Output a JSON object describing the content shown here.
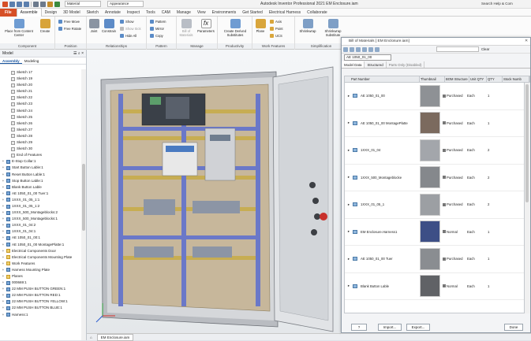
{
  "window": {
    "title": "Autodesk Inventor Professional 2021   EM Enclosure.iam",
    "material": "Material",
    "appearance": "Appearance",
    "help_search": "Search Help & Com"
  },
  "tabs": [
    "File",
    "Assemble",
    "Design",
    "3D Model",
    "Sketch",
    "Annotate",
    "Inspect",
    "Tools",
    "CAM",
    "Manage",
    "View",
    "Environments",
    "Get Started",
    "Electrical Harness",
    "Collaborate"
  ],
  "ribbon": {
    "component": {
      "label": "Component",
      "place": "Place from Content Center",
      "create": "Create"
    },
    "position": {
      "label": "Position",
      "free_move": "Free Move",
      "free_rotate": "Free Rotate"
    },
    "relationships": {
      "label": "Relationships",
      "joint": "Joint",
      "constrain": "Constrain",
      "show": "Show",
      "show_sick": "Show Sick",
      "hide_all": "Hide All"
    },
    "pattern": {
      "label": "Pattern",
      "pattern": "Pattern",
      "mirror": "Mirror",
      "copy": "Copy"
    },
    "manage": {
      "label": "Manage",
      "bom": "Bill of Materials",
      "parameters": "Parameters"
    },
    "productivity": {
      "label": "Productivity",
      "create_derived": "Create Derived Substitutes"
    },
    "work_features": {
      "label": "Work Features",
      "plane": "Plane",
      "axis": "Axis",
      "point": "Point",
      "ucs": "UCS"
    },
    "simplification": {
      "label": "Simplification",
      "shrinkwrap": "Shrinkwrap",
      "shrinkwrap_sub": "Shrinkwrap Substitute"
    }
  },
  "browser": {
    "title": "Model",
    "tabs": [
      "Assembly",
      "Modeling"
    ],
    "items": [
      {
        "label": "Sketch 17",
        "icon": "s",
        "pm": ""
      },
      {
        "label": "Sketch 19",
        "icon": "s",
        "pm": ""
      },
      {
        "label": "Sketch 20",
        "icon": "s",
        "pm": ""
      },
      {
        "label": "Sketch 21",
        "icon": "s",
        "pm": ""
      },
      {
        "label": "Sketch 22",
        "icon": "s",
        "pm": ""
      },
      {
        "label": "Sketch 23",
        "icon": "s",
        "pm": ""
      },
      {
        "label": "Sketch 24",
        "icon": "s",
        "pm": ""
      },
      {
        "label": "Sketch 25",
        "icon": "s",
        "pm": ""
      },
      {
        "label": "Sketch 26",
        "icon": "s",
        "pm": ""
      },
      {
        "label": "Sketch 27",
        "icon": "s",
        "pm": ""
      },
      {
        "label": "Sketch 28",
        "icon": "s",
        "pm": ""
      },
      {
        "label": "Sketch 29",
        "icon": "s",
        "pm": ""
      },
      {
        "label": "Sketch 30",
        "icon": "s",
        "pm": ""
      },
      {
        "label": "End of Features",
        "icon": "s",
        "pm": ""
      },
      {
        "label": "E-Stop Collar:1",
        "icon": "p",
        "pm": "+"
      },
      {
        "label": "Start Button Lable:1",
        "icon": "p",
        "pm": "+"
      },
      {
        "label": "Reset Button Lable:1",
        "icon": "p",
        "pm": "+"
      },
      {
        "label": "Stop Button Lable:1",
        "icon": "p",
        "pm": "+"
      },
      {
        "label": "Blank Button Lable",
        "icon": "p",
        "pm": "+"
      },
      {
        "label": "AE 1050_01_00 Tuer:1",
        "icon": "p",
        "pm": "+"
      },
      {
        "label": "1XXX_01_05_1:1",
        "icon": "p",
        "pm": "+"
      },
      {
        "label": "1XXX_01_05_1:2",
        "icon": "p",
        "pm": "+"
      },
      {
        "label": "1XXX_500_Montageblocks:2",
        "icon": "p",
        "pm": "+"
      },
      {
        "label": "1XXX_500_Montageblocks:1",
        "icon": "p",
        "pm": "+"
      },
      {
        "label": "1XXX_01_04:2",
        "icon": "p",
        "pm": "+"
      },
      {
        "label": "1XXX_01_04:1",
        "icon": "p",
        "pm": "+"
      },
      {
        "label": "AE 1050_01_00:1",
        "icon": "p",
        "pm": "+"
      },
      {
        "label": "AE 1050_01_00 MontagePlatte:1",
        "icon": "p",
        "pm": "+"
      },
      {
        "label": "Electrical Components Door",
        "icon": "f",
        "pm": "+"
      },
      {
        "label": "Electrical Components Mounting Plate",
        "icon": "f",
        "pm": "+"
      },
      {
        "label": "Work Features",
        "icon": "f",
        "pm": "+"
      },
      {
        "label": "Harness Mounting Plate",
        "icon": "p",
        "pm": "+"
      },
      {
        "label": "Planes",
        "icon": "f",
        "pm": "+"
      },
      {
        "label": "000669:1",
        "icon": "p",
        "pm": "+"
      },
      {
        "label": "22 MM PUSH BUTTON GREEN:1",
        "icon": "p",
        "pm": "+"
      },
      {
        "label": "22 MM PUSH BUTTON RED:1",
        "icon": "p",
        "pm": "+"
      },
      {
        "label": "22 MM PUSH BUTTON YELLOW:1",
        "icon": "p",
        "pm": "+"
      },
      {
        "label": "22 MM PUSH BUTTON BLUE:1",
        "icon": "p",
        "pm": "+"
      },
      {
        "label": "Harness:1",
        "icon": "p",
        "pm": "+"
      }
    ]
  },
  "document_tabs": [
    "EM Enclosure.iam"
  ],
  "bom": {
    "title": "Bill of Materials [ EM Enclosure.iam]",
    "assembly_name": "AE 1050_01_00",
    "clear_label": "Clear",
    "tabs": [
      "Model Data",
      "Structured",
      "Parts Only (Disabled)"
    ],
    "columns": [
      "Part Number",
      "Thumbnail",
      "BOM Structure",
      "Unit QTY",
      "QTY",
      "Stock Numb"
    ],
    "rows": [
      {
        "part": "AE 1050_01_00",
        "structure": "Purchased",
        "unit": "Each",
        "qty": "1",
        "thumb": "#8e9195"
      },
      {
        "part": "AE 1050_01_00 MontagePlatte",
        "structure": "Purchased",
        "unit": "Each",
        "qty": "1",
        "thumb": "#7b6a5e"
      },
      {
        "part": "1XXX_01_04",
        "structure": "Purchased",
        "unit": "Each",
        "qty": "2",
        "thumb": "#a3a6ab"
      },
      {
        "part": "1XXX_500_Montageblocke",
        "structure": "Purchased",
        "unit": "Each",
        "qty": "2",
        "thumb": "#85888c"
      },
      {
        "part": "1XXX_01_05_1",
        "structure": "Purchased",
        "unit": "Each",
        "qty": "2",
        "thumb": "#9c9fa3"
      },
      {
        "part": "EM Enclosure.Harness1",
        "structure": "Normal",
        "unit": "Each",
        "qty": "1",
        "thumb": "#3d4f86"
      },
      {
        "part": "AE 1050_01_00 Tuer",
        "structure": "Purchased",
        "unit": "Each",
        "qty": "1",
        "thumb": "#8a8d91"
      },
      {
        "part": "Blank Button Lable",
        "structure": "Normal",
        "unit": "Each",
        "qty": "1",
        "thumb": "#606266"
      }
    ],
    "footer": {
      "help": "?",
      "import": "Import...",
      "export": "Export...",
      "done": "Done"
    }
  }
}
